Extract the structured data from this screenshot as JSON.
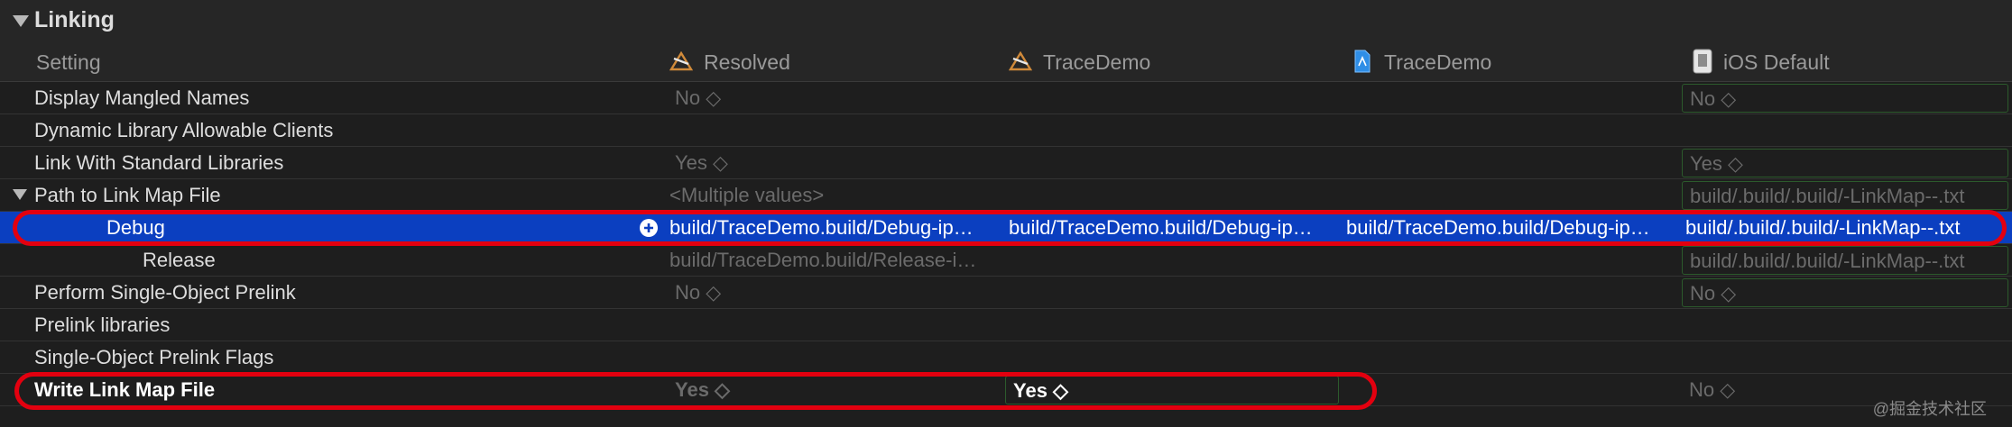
{
  "section": {
    "title": "Linking"
  },
  "columns": {
    "setting": "Setting",
    "resolved": "Resolved",
    "target1": "TraceDemo",
    "target2": "TraceDemo",
    "ios_default": "iOS Default"
  },
  "rows": [
    {
      "label": "Display Mangled Names",
      "resolved": "No ◇",
      "ios_default": "No ◇"
    },
    {
      "label": "Dynamic Library Allowable Clients"
    },
    {
      "label": "Link With Standard Libraries",
      "resolved": "Yes ◇",
      "ios_default": "Yes ◇"
    },
    {
      "label": "Path to Link Map File",
      "resolved": "<Multiple values>",
      "ios_default": "build/.build/.build/-LinkMap--.txt"
    },
    {
      "label": "Debug",
      "resolved": "build/TraceDemo.build/Debug-ip…",
      "target1": "build/TraceDemo.build/Debug-ip…",
      "target2": "build/TraceDemo.build/Debug-ip…",
      "ios_default": "build/.build/.build/-LinkMap--.txt"
    },
    {
      "label": "Release",
      "resolved": "build/TraceDemo.build/Release-i…",
      "ios_default": "build/.build/.build/-LinkMap--.txt"
    },
    {
      "label": "Perform Single-Object Prelink",
      "resolved": "No ◇",
      "ios_default": "No ◇"
    },
    {
      "label": "Prelink libraries"
    },
    {
      "label": "Single-Object Prelink Flags"
    },
    {
      "label": "Write Link Map File",
      "resolved": "Yes ◇",
      "target1": "Yes ◇",
      "ios_default": "No ◇"
    }
  ],
  "watermark": "@掘金技术社区",
  "colors": {
    "selection": "#0b3fc0",
    "annotation": "#e3000f",
    "override_border": "#2c5a2c"
  }
}
